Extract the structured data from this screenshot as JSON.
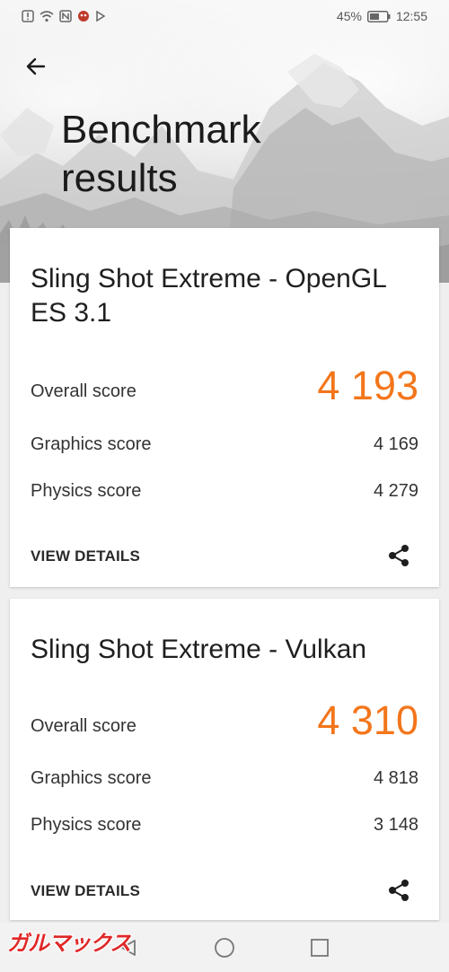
{
  "status_bar": {
    "battery": "45%",
    "time": "12:55"
  },
  "header": {
    "title": "Benchmark results"
  },
  "results": [
    {
      "title": "Sling Shot Extreme - OpenGL ES 3.1",
      "overall_label": "Overall score",
      "overall_value": "4 193",
      "graphics_label": "Graphics score",
      "graphics_value": "4 169",
      "physics_label": "Physics score",
      "physics_value": "4 279",
      "details_label": "VIEW DETAILS"
    },
    {
      "title": "Sling Shot Extreme - Vulkan",
      "overall_label": "Overall score",
      "overall_value": "4 310",
      "graphics_label": "Graphics score",
      "graphics_value": "4 818",
      "physics_label": "Physics score",
      "physics_value": "3 148",
      "details_label": "VIEW DETAILS"
    }
  ],
  "watermark": "ガルマックス",
  "colors": {
    "accent": "#f3761b",
    "card": "#ffffff",
    "background": "#efefef"
  },
  "icons": [
    "alert-icon",
    "wifi-icon",
    "nfc-icon",
    "app-icon",
    "play-icon",
    "battery-icon",
    "back-arrow-icon",
    "share-icon",
    "nav-back-icon",
    "nav-home-icon",
    "nav-recents-icon"
  ]
}
